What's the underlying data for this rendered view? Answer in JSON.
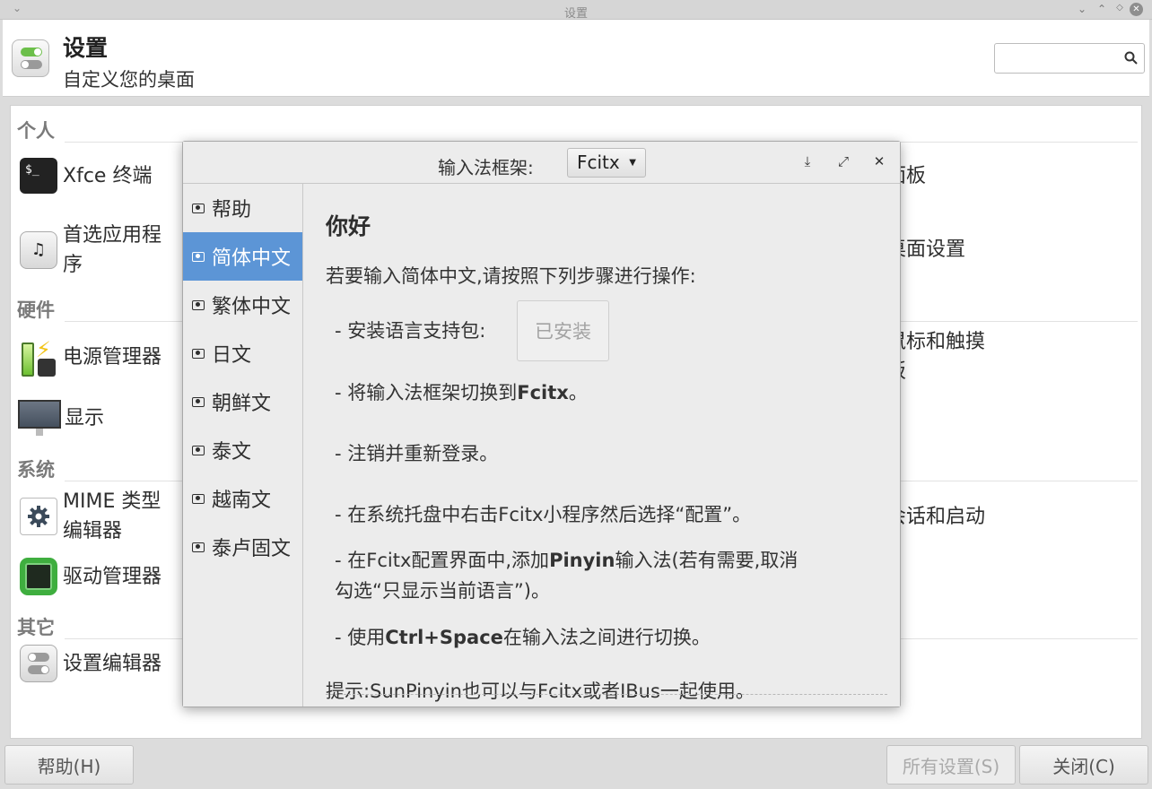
{
  "window": {
    "title": "设置"
  },
  "header": {
    "title": "设置",
    "subtitle": "自定义您的桌面",
    "search_placeholder": ""
  },
  "categories": {
    "personal": "个人",
    "hardware": "硬件",
    "system": "系统",
    "other": "其它"
  },
  "items": {
    "terminal": "Xfce 终端",
    "preferred_apps_1": "首选应用程",
    "preferred_apps_2": "序",
    "power": "电源管理器",
    "display": "显示",
    "mime_1": "MIME 类型",
    "mime_2": "编辑器",
    "driver": "驱动管理器",
    "settings_editor": "设置编辑器"
  },
  "items_right": {
    "panel": "面板",
    "desktop": "桌面设置",
    "mouse_1": "鼠标和触摸",
    "mouse_2": "板",
    "session": "会话和启动"
  },
  "icons": {
    "terminal_glyph": "$_",
    "apps_glyph": "♫"
  },
  "footer": {
    "help": "帮助(H)",
    "all_settings": "所有设置(S)",
    "close": "关闭(C)"
  },
  "dialog": {
    "framework_label": "输入法框架:",
    "framework_value": "Fcitx",
    "sidebar": [
      {
        "label": "帮助"
      },
      {
        "label": "简体中文"
      },
      {
        "label": "繁体中文"
      },
      {
        "label": "日文"
      },
      {
        "label": "朝鲜文"
      },
      {
        "label": "泰文"
      },
      {
        "label": "越南文"
      },
      {
        "label": "泰卢固文"
      }
    ],
    "heading": "你好",
    "intro": "若要输入简体中文,请按照下列步骤进行操作:",
    "step1": "- 安装语言支持包:",
    "installed_button": "已安装",
    "step2_pre": "- 将输入法框架切换到",
    "step2_bold": "Fcitx",
    "step2_post": "。",
    "step3": "- 注销并重新登录。",
    "step4": "- 在系统托盘中右击Fcitx小程序然后选择“配置”。",
    "step5_pre": "- 在Fcitx配置界面中,添加",
    "step5_bold": "Pinyin",
    "step5_post": "输入法(若有需要,取消",
    "step5_line2": "勾选“只显示当前语言”)。",
    "step6_pre": "- 使用",
    "step6_bold": "Ctrl+Space",
    "step6_post": "在输入法之间进行切换。",
    "tip": "提示:SunPinyin也可以与Fcitx或者IBus一起使用。"
  },
  "colors": {
    "selection": "#5c95d6",
    "accent_green": "#6cbf4a"
  }
}
